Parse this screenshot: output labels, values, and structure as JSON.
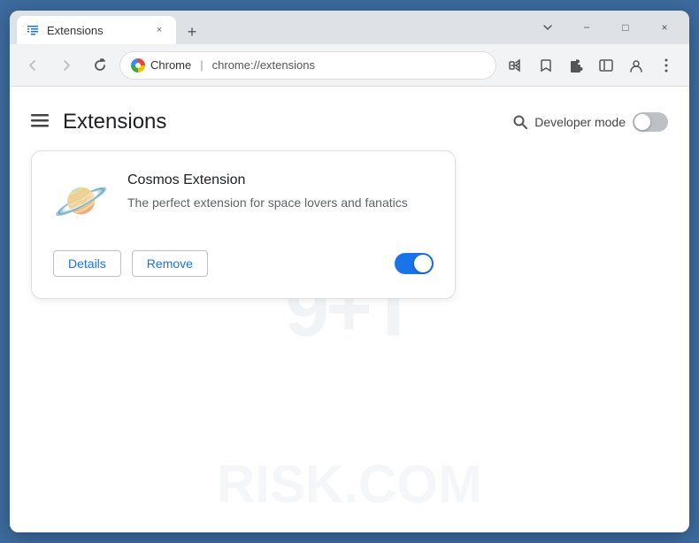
{
  "browser": {
    "tab": {
      "favicon": "puzzle-piece",
      "title": "Extensions",
      "close_label": "×"
    },
    "new_tab_label": "+",
    "window_controls": {
      "minimize": "−",
      "maximize": "□",
      "close": "×"
    },
    "toolbar": {
      "back_label": "←",
      "forward_label": "→",
      "reload_label": "↻",
      "site_name": "Chrome",
      "url": "chrome://extensions",
      "share_icon": "share",
      "bookmark_icon": "star",
      "extensions_icon": "puzzle",
      "sidebar_icon": "sidebar",
      "profile_icon": "person",
      "menu_icon": "⋮"
    }
  },
  "page": {
    "title": "Extensions",
    "search_label": "Search",
    "developer_mode_label": "Developer mode",
    "developer_mode_on": false
  },
  "extension": {
    "name": "Cosmos Extension",
    "description": "The perfect extension for space lovers and fanatics",
    "details_button": "Details",
    "remove_button": "Remove",
    "enabled": true
  },
  "watermark": {
    "top": "9+T",
    "bottom": "RISK.COM"
  }
}
